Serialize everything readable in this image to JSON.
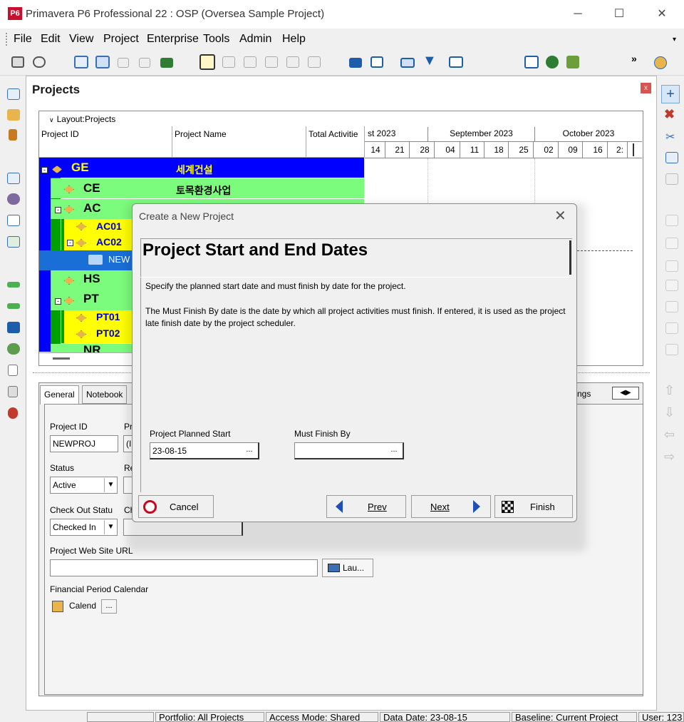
{
  "window": {
    "app_icon": "P6",
    "title": "Primavera P6 Professional 22 : OSP (Oversea Sample Project)",
    "minimize": "─",
    "maximize": "☐",
    "close": "✕"
  },
  "menu": [
    "File",
    "Edit",
    "View",
    "Project",
    "Enterprise",
    "Tools",
    "Admin",
    "Help"
  ],
  "panel": {
    "title": "Projects",
    "close": "x"
  },
  "grid": {
    "layout_label": "Layout:Projects",
    "headers": [
      "Project ID",
      "Project Name",
      "Total Activitie"
    ],
    "months": [
      "st 2023",
      "September 2023",
      "October 2023"
    ],
    "days": [
      "14",
      "21",
      "28",
      "04",
      "11",
      "18",
      "25",
      "02",
      "09",
      "16",
      "2:"
    ],
    "rows": [
      {
        "id": "GE",
        "name": "세계건설"
      },
      {
        "id": "CE",
        "name": "토목환경사업"
      },
      {
        "id": "AC",
        "name": ""
      },
      {
        "id": "AC01",
        "name": ""
      },
      {
        "id": "AC02",
        "name": ""
      },
      {
        "id": "NEW",
        "name": ""
      },
      {
        "id": "HS",
        "name": ""
      },
      {
        "id": "PT",
        "name": ""
      },
      {
        "id": "PT01",
        "name": ""
      },
      {
        "id": "PT02",
        "name": ""
      },
      {
        "id": "NR",
        "name": ""
      }
    ]
  },
  "details": {
    "tabs": [
      "General",
      "Notebook",
      "ngs"
    ],
    "project_id_label": "Project ID",
    "project_id_value": "NEWPROJ",
    "project_name_label_partial": "Pr",
    "project_name_value_partial": "(I",
    "status_label": "Status",
    "status_value": "Active",
    "resp_label_partial": "Re",
    "checkout_label": "Check Out Statu",
    "checkout_label2_partial": "Ch",
    "checkout_value": "Checked In",
    "web_url_label": "Project Web Site URL",
    "launch_button": "Lau...",
    "fin_calendar_label": "Financial Period Calendar",
    "fin_calendar_value": "Calend",
    "dots": "..."
  },
  "dialog": {
    "title": "Create a New Project",
    "close": "✕",
    "heading": "Project Start and End Dates",
    "text1": "Specify the planned start date and must finish by date for the project.",
    "text2": "The Must Finish By date is the date by which all project activities must finish.  If entered, it is used as the project late finish date by the project scheduler.",
    "planned_start_label": "Project Planned Start",
    "planned_start_value": "23-08-15",
    "must_finish_label": "Must Finish By",
    "must_finish_value": "",
    "dots": "...",
    "cancel": "Cancel",
    "prev": "Prev",
    "next": "Next",
    "finish": "Finish"
  },
  "status": {
    "portfolio": "Portfolio: All Projects",
    "access": "Access Mode: Shared",
    "data_date": "Data Date: 23-08-15",
    "baseline": "Baseline: Current Project",
    "user": "User: 123"
  },
  "colors": {
    "selected_row": "#0000ff",
    "green_row": "#7cfc7c",
    "yellow_row": "#ffff00",
    "dark_green_bar": "#008000",
    "brand_red": "#c8102e"
  }
}
